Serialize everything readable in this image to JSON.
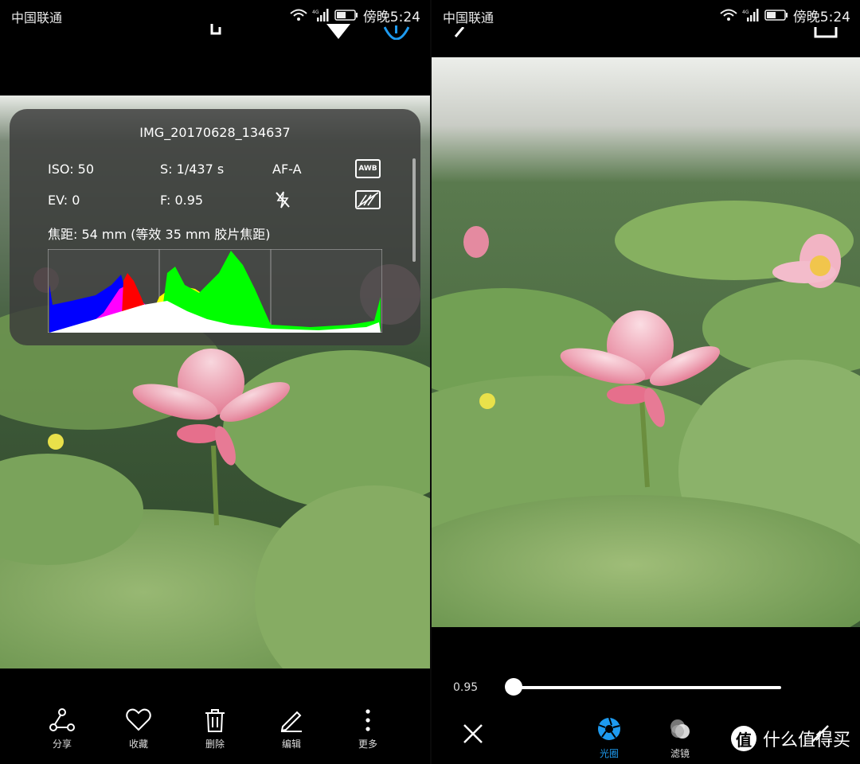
{
  "status_bar": {
    "carrier": "中国联通",
    "network": "4G",
    "time": "傍晚5:24"
  },
  "left_screen": {
    "photo_info": {
      "filename": "IMG_20170628_134637",
      "iso": "ISO: 50",
      "shutter": "S: 1/437 s",
      "af_mode": "AF-A",
      "white_balance_icon": "AWB",
      "ev": "EV: 0",
      "aperture": "F: 0.95",
      "flash_icon": "flash-off-icon",
      "hdr_icon": "hdr-off-icon",
      "focal_length": "焦距: 54 mm (等效 35 mm 胶片焦距)",
      "histogram_colors": [
        "#0000ff",
        "#ff00ff",
        "#ff0000",
        "#ffff00",
        "#00ff00",
        "#ffffff"
      ]
    },
    "toolbar": [
      {
        "icon": "share-icon",
        "label": "分享"
      },
      {
        "icon": "heart-icon",
        "label": "收藏"
      },
      {
        "icon": "trash-icon",
        "label": "删除"
      },
      {
        "icon": "edit-icon",
        "label": "编辑"
      },
      {
        "icon": "more-icon",
        "label": "更多"
      }
    ]
  },
  "right_screen": {
    "aperture_value": "0.95",
    "aperture_fraction": 0.0,
    "tools": [
      {
        "icon": "close-icon"
      },
      {
        "icon": "aperture-icon",
        "label": "光圈",
        "active": true,
        "color": "#1e9bf0"
      },
      {
        "icon": "filter-icon",
        "label": "滤镜"
      }
    ],
    "watermark": {
      "logo": "值",
      "text": "什么值得买"
    }
  }
}
